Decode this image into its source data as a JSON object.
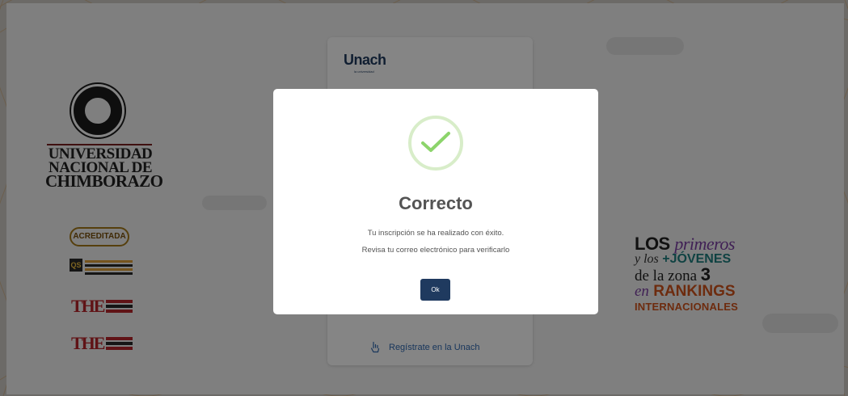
{
  "background": {
    "university_name": [
      "UNIVERSIDAD",
      "NACIONAL DE",
      "CHIMBORAZO"
    ],
    "accreditation_badge": "ACREDITADA",
    "ranking_badges": {
      "qs": "QS",
      "the": "THE"
    },
    "ranking_slogan": {
      "word_los": "LOS",
      "word_primeros": "primeros",
      "word_y_los": "y los",
      "word_plus_jovenes": "+JÓVENES",
      "word_de_la_zona": "de la zona",
      "zone_number": "3",
      "word_en": "en",
      "word_rankings": "RANKINGS",
      "word_internacionales": "INTERNACIONALES"
    }
  },
  "login_card": {
    "brand": "Unach",
    "brand_tagline": "la universidad",
    "register_link": "Regístrate en la Unach",
    "register_icon": "hand-pointer-icon"
  },
  "modal": {
    "icon": "check-icon",
    "title": "Correcto",
    "message_line1": "Tu inscripción se ha realizado con éxito.",
    "message_line2": "Revisa tu correo electrónico para verificarlo",
    "ok_label": "Ok"
  },
  "colors": {
    "brand_navy": "#1f3a5f",
    "success_green": "#8cd46b",
    "success_ring": "#d8edc9",
    "overlay": "rgba(0,0,0,0.48)"
  }
}
